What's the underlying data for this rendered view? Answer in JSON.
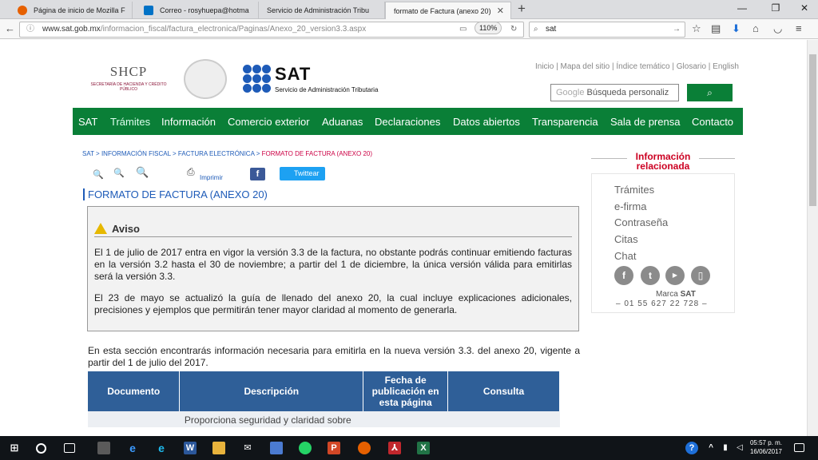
{
  "tabs": [
    {
      "title": "Página de inicio de Mozilla F",
      "icon_color": "#e66000"
    },
    {
      "title": "Correo - rosyhuepa@hotma",
      "icon_color": "#0072c6"
    },
    {
      "title": "Servicio de Administración Tribu",
      "icon_color": "#888888"
    },
    {
      "title": "formato de Factura (anexo 20)",
      "icon_color": "#888888"
    }
  ],
  "browser": {
    "url_domain": "www.sat.gob.mx",
    "url_path": "/informacion_fiscal/factura_electronica/Paginas/Anexo_20_version3.3.aspx",
    "zoom": "110%",
    "search_value": "sat"
  },
  "header": {
    "utility_links": "Inicio | Mapa del sitio | Índice temático | Glosario | English",
    "search_placeholder": "Búsqueda personaliz",
    "google_label": "Google",
    "shcp_title": "SHCP",
    "shcp_subtitle": "SECRETARÍA DE HACIENDA Y CRÉDITO PÚBLICO",
    "sat_name": "SAT",
    "sat_subtitle": "Servicio de Administración Tributaria"
  },
  "nav": [
    "SAT",
    "Trámites",
    "Información",
    "Comercio exterior",
    "Aduanas",
    "Declaraciones",
    "Datos abiertos",
    "Transparencia",
    "Sala de prensa",
    "Contacto"
  ],
  "breadcrumb": {
    "items": [
      "SAT",
      "INFORMACIÓN FISCAL",
      "FACTURA ELECTRÓNICA"
    ],
    "current": "FORMATO DE FACTURA (ANEXO 20)"
  },
  "tools": {
    "print": "Imprimir",
    "twitter": "Twittear"
  },
  "page_title": "FORMATO DE FACTURA (ANEXO 20)",
  "aviso": {
    "title": "Aviso",
    "p1": "El 1 de julio de 2017 entra en vigor la versión 3.3 de la factura, no obstante podrás continuar emitiendo facturas en la versión 3.2 hasta el 30 de noviembre; a partir del 1 de diciembre, la única versión válida para emitirlas será la versión 3.3.",
    "p2": "El 23 de mayo se actualizó la guía de llenado del anexo 20, la cual incluye explicaciones adicionales, precisiones y ejemplos que permitirán tener mayor claridad al momento de generarla."
  },
  "intro": "En esta sección encontrarás información necesaria para emitirla en la nueva versión 3.3. del anexo 20, vigente a partir del 1 de julio del 2017.",
  "table": {
    "headers": [
      "Documento",
      "Descripción",
      "Fecha de publicación en esta página",
      "Consulta"
    ],
    "first_row_description": "Proporciona seguridad y claridad sobre"
  },
  "sidebar": {
    "title_line1": "Información",
    "title_line2": "relacionada",
    "items": [
      "Trámites",
      "e-firma",
      "Contraseña",
      "Citas",
      "Chat"
    ],
    "marca_prefix": "Marca",
    "marca_bold": "SAT",
    "phone": "–   01 55 627 22 728   –"
  },
  "taskbar": {
    "time": "05:57 p. m.",
    "date": "16/06/2017"
  }
}
